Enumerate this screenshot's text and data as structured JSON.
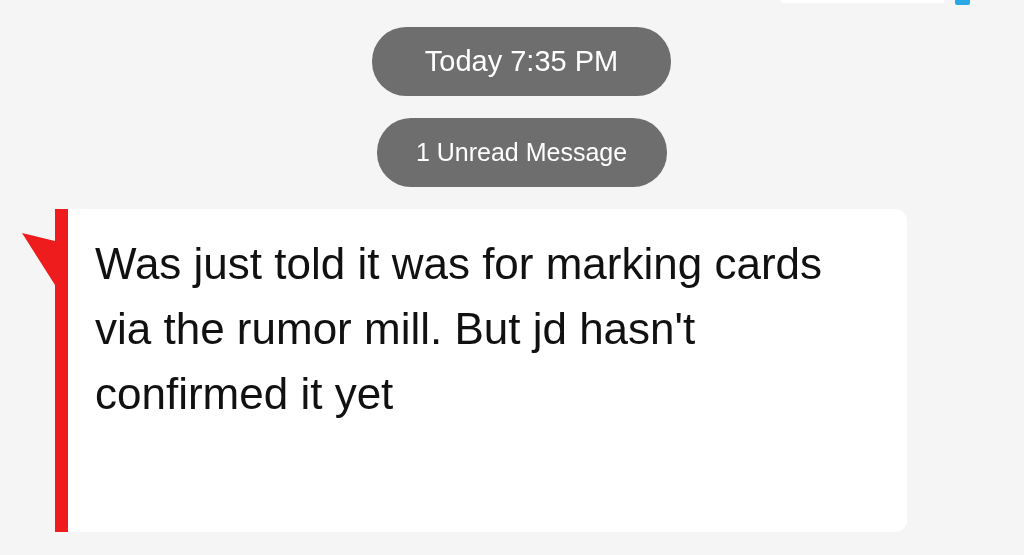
{
  "timestamp": "Today 7:35 PM",
  "unread_divider": "1 Unread Message",
  "messages": [
    {
      "kind": "incoming",
      "text": "Was just told it was for marking cards via the rumor mill. But jd hasn't confirmed it yet",
      "unread": true
    }
  ]
}
